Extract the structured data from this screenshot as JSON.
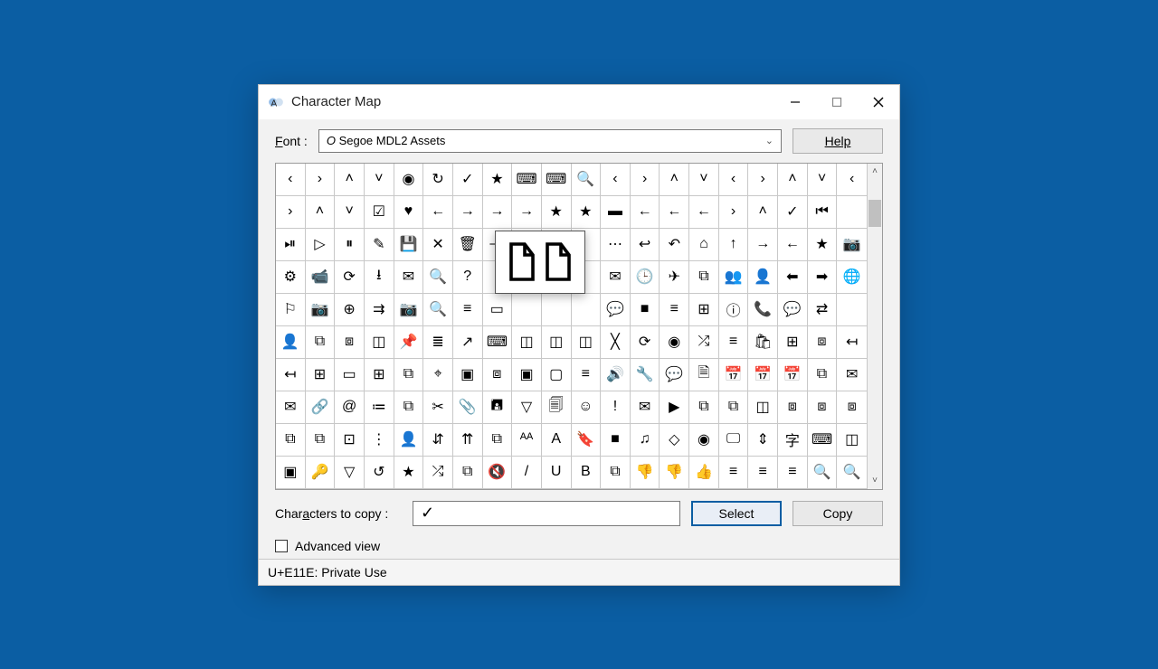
{
  "title": "Character Map",
  "font_label": "Font :",
  "font_value": "Segoe MDL2 Assets",
  "help_label": "Help",
  "copy_label": "Characters to copy :",
  "copy_value": "✓",
  "select_label": "Select",
  "copy_btn_label": "Copy",
  "adv_label": "Advanced view",
  "adv_checked": false,
  "status": "U+E11E: Private Use",
  "glyph_rows": [
    [
      "‹",
      "›",
      "˄",
      "˅",
      "◉",
      "↻",
      "✓",
      "★",
      "⌨",
      "⌨",
      "🔍",
      "‹",
      "›",
      "˄",
      "˅",
      "‹",
      "›",
      "˄",
      "˅",
      "‹"
    ],
    [
      "›",
      "˄",
      "˅",
      "☑",
      "♥",
      "←",
      "→",
      "→",
      "→",
      "★",
      "★",
      "▬",
      "←",
      "←",
      "←",
      "›",
      "˄",
      "✓",
      "⏮",
      ""
    ],
    [
      "⏯",
      "▷",
      "⏸",
      "✎",
      "💾",
      "✕",
      "🗑",
      "—",
      "",
      "",
      "",
      "⋯",
      "↩",
      "↶",
      "⌂",
      "↑",
      "→",
      "←",
      "★",
      "📷"
    ],
    [
      "⚙",
      "📹",
      "⟳",
      "⭳",
      "✉",
      "🔍",
      "?",
      "",
      "",
      "",
      "",
      "✉",
      "🕒",
      "✈",
      "⧉",
      "👥",
      "👤",
      "⬅",
      "➡",
      "🌐"
    ],
    [
      "⚐",
      "📷",
      "⊕",
      "⇉",
      "📷",
      "🔍",
      "≡",
      "▭",
      "",
      "",
      "",
      "💬",
      "■",
      "≡",
      "⊞",
      "ⓘ",
      "📞",
      "💬",
      "⇄",
      ""
    ],
    [
      "👤",
      "⧉",
      "⧈",
      "◫",
      "📌",
      "≣",
      "↗",
      "⌨",
      "◫",
      "◫",
      "◫",
      "╳",
      "⟳",
      "◉",
      "⤮",
      "≡",
      "🛍",
      "⊞",
      "⧈",
      "↤"
    ],
    [
      "↤",
      "⊞",
      "▭",
      "⊞",
      "⧉",
      "⌖",
      "▣",
      "⧈",
      "▣",
      "▢",
      "≡",
      "🔊",
      "🔧",
      "💬",
      "🗎",
      "📅",
      "📅",
      "📅",
      "⧉",
      "✉"
    ],
    [
      "✉",
      "🔗",
      "@",
      "≔",
      "⧉",
      "✂",
      "📎",
      "🖪",
      "▽",
      "🗐",
      "☺",
      "!",
      "✉",
      "▶",
      "⧉",
      "⧉",
      "◫",
      "⧈",
      "⧈",
      "⧈"
    ],
    [
      "⧉",
      "⧉",
      "⊡",
      "⋮",
      "👤",
      "⇵",
      "⇈",
      "⧉",
      "ᴬᴬ",
      "A",
      "🔖",
      "■",
      "♫",
      "◇",
      "◉",
      "🖵",
      "⇕",
      "字",
      "⌨",
      "◫"
    ],
    [
      "▣",
      "🔑",
      "▽",
      "↺",
      "★",
      "⤮",
      "⧉",
      "🔇",
      "/",
      "U",
      "B",
      "⧉",
      "👎",
      "👎",
      "👍",
      "≡",
      "≡",
      "≡",
      "🔍",
      "🔍"
    ]
  ]
}
